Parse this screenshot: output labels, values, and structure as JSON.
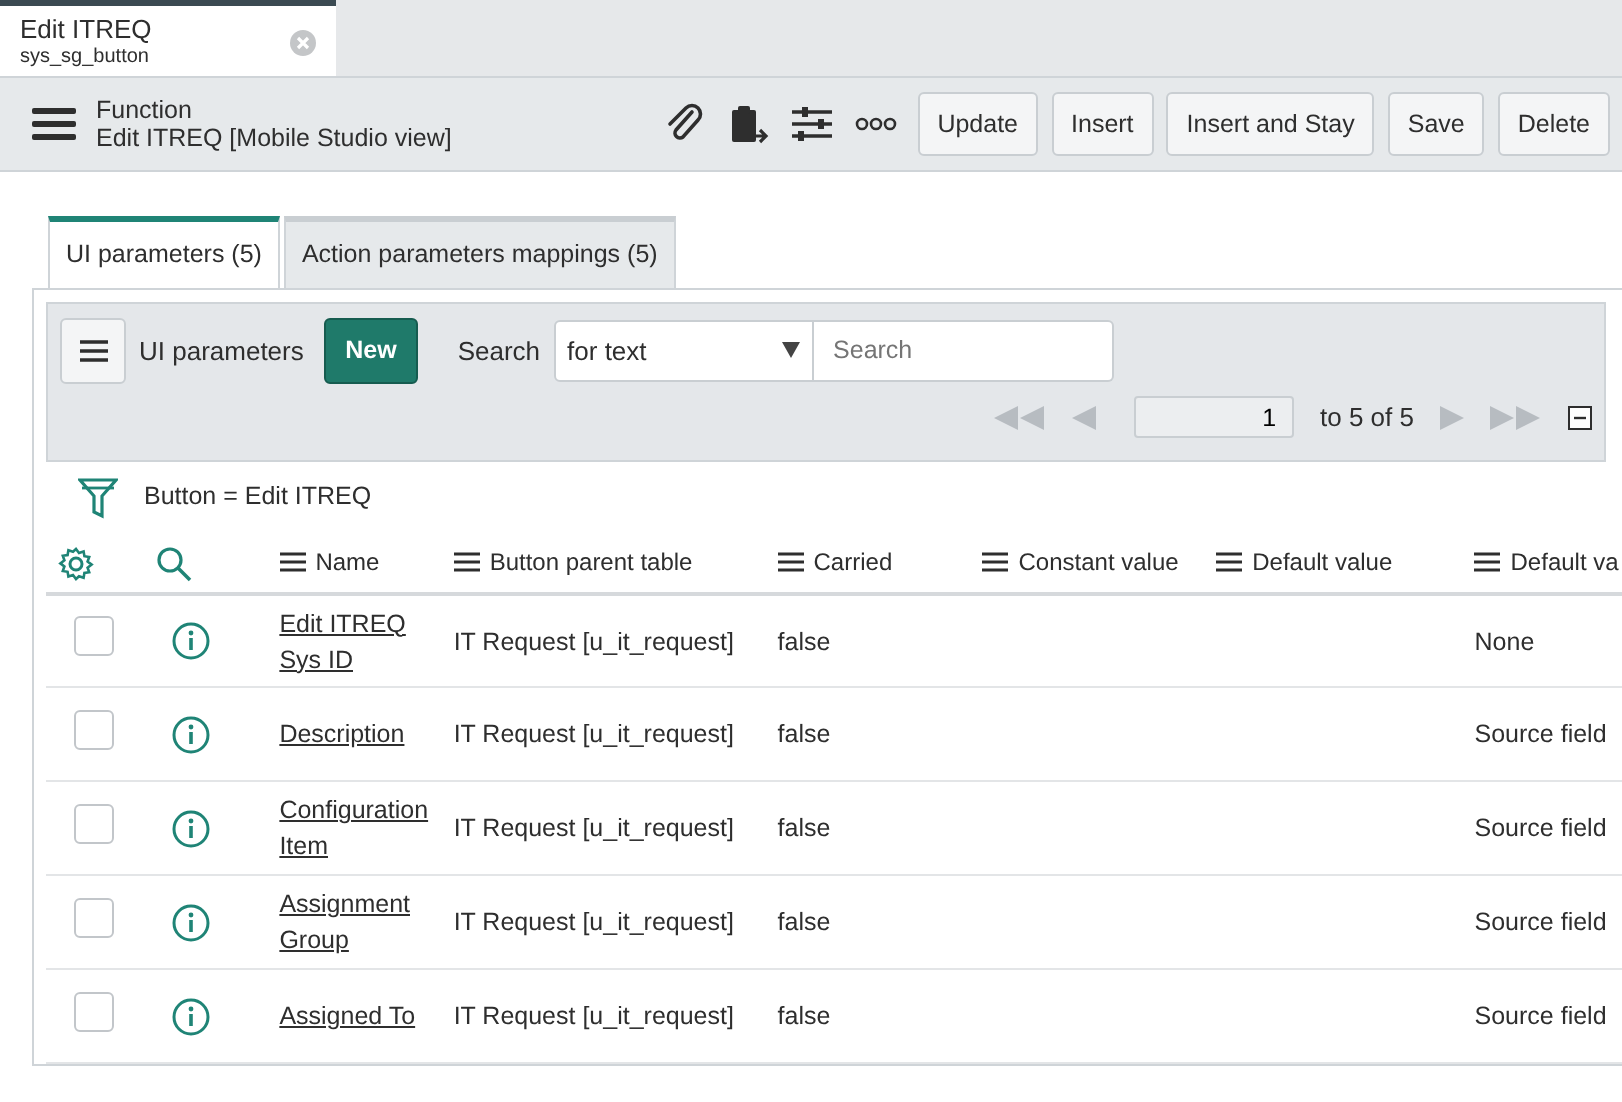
{
  "record_tab": {
    "title": "Edit ITREQ",
    "subtitle": "sys_sg_button"
  },
  "header": {
    "label": "Function",
    "title": "Edit ITREQ [Mobile Studio view]",
    "buttons": [
      "Update",
      "Insert",
      "Insert and Stay",
      "Save",
      "Delete"
    ]
  },
  "tabs": [
    {
      "label": "UI parameters (5)",
      "selected": true
    },
    {
      "label": "Action parameters mappings (5)",
      "selected": false
    }
  ],
  "list": {
    "title": "UI parameters",
    "new_button": "New",
    "search_label": "Search",
    "search_select": "for text",
    "search_placeholder": "Search",
    "page": "1",
    "range": "to 5 of 5"
  },
  "filter": "Button = Edit ITREQ",
  "columns": [
    "Name",
    "Button parent table",
    "Carried",
    "Constant value",
    "Default value",
    "Default va"
  ],
  "rows": [
    {
      "checked": false,
      "name": "Edit ITREQ Sys ID",
      "table": "IT Request [u_it_request]",
      "carried": "false",
      "default_type": "None"
    },
    {
      "checked": false,
      "name": "Description",
      "table": "IT Request [u_it_request]",
      "carried": "false",
      "default_type": "Source field"
    },
    {
      "checked": false,
      "name": "Configuration Item",
      "table": "IT Request [u_it_request]",
      "carried": "false",
      "default_type": "Source field"
    },
    {
      "checked": false,
      "name": "Assignment Group",
      "table": "IT Request [u_it_request]",
      "carried": "false",
      "default_type": "Source field"
    },
    {
      "checked": false,
      "name": "Assigned To",
      "table": "IT Request [u_it_request]",
      "carried": "false",
      "default_type": "Source field"
    }
  ]
}
